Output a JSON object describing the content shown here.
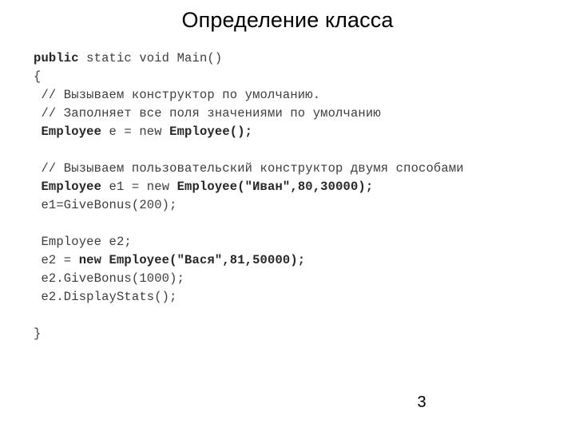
{
  "slide": {
    "title": "Определение класса",
    "page_number": "3",
    "background_color": "#ffffff",
    "text_color": "#3a3a3a",
    "title_color": "#000000"
  },
  "code": {
    "language": "csharp",
    "lines": [
      {
        "id": "line-1",
        "indent": 0,
        "tokens": [
          {
            "text": "public",
            "bold": true
          },
          {
            "text": " static void Main()",
            "bold": false
          }
        ]
      },
      {
        "id": "line-2",
        "indent": 0,
        "tokens": [
          {
            "text": "{",
            "bold": false
          }
        ]
      },
      {
        "id": "line-3",
        "indent": 1,
        "tokens": [
          {
            "text": "// Вызываем конструктор по умолчанию.",
            "bold": false
          }
        ]
      },
      {
        "id": "line-4",
        "indent": 1,
        "tokens": [
          {
            "text": "// Заполняет все поля значениями по умолчанию",
            "bold": false
          }
        ]
      },
      {
        "id": "line-5",
        "indent": 1,
        "tokens": [
          {
            "text": "Employee",
            "bold": true
          },
          {
            "text": " e = new ",
            "bold": false
          },
          {
            "text": "Employee();",
            "bold": true
          }
        ]
      },
      {
        "id": "line-6",
        "indent": 0,
        "tokens": [
          {
            "text": "",
            "bold": false
          }
        ]
      },
      {
        "id": "line-7",
        "indent": 1,
        "tokens": [
          {
            "text": "// Вызываем пользовательский конструктор двумя способами",
            "bold": false
          }
        ]
      },
      {
        "id": "line-8",
        "indent": 1,
        "tokens": [
          {
            "text": "Employee",
            "bold": true
          },
          {
            "text": " e1 = new ",
            "bold": false
          },
          {
            "text": "Employee(\"Иван\",80,30000);",
            "bold": true
          }
        ]
      },
      {
        "id": "line-9",
        "indent": 1,
        "tokens": [
          {
            "text": "e1=GiveBonus(200);",
            "bold": false
          }
        ]
      },
      {
        "id": "line-10",
        "indent": 0,
        "tokens": [
          {
            "text": "",
            "bold": false
          }
        ]
      },
      {
        "id": "line-11",
        "indent": 1,
        "tokens": [
          {
            "text": "Employee e2;",
            "bold": false
          }
        ]
      },
      {
        "id": "line-12",
        "indent": 1,
        "tokens": [
          {
            "text": "e2 = ",
            "bold": false
          },
          {
            "text": "new Employee(\"Вася\",81,50000);",
            "bold": true
          }
        ]
      },
      {
        "id": "line-13",
        "indent": 1,
        "tokens": [
          {
            "text": "e2.GiveBonus(1000);",
            "bold": false
          }
        ]
      },
      {
        "id": "line-14",
        "indent": 1,
        "tokens": [
          {
            "text": "e2.DisplayStats();",
            "bold": false
          }
        ]
      },
      {
        "id": "line-15",
        "indent": 0,
        "tokens": [
          {
            "text": "",
            "bold": false
          }
        ]
      },
      {
        "id": "line-16",
        "indent": 0,
        "tokens": [
          {
            "text": "}",
            "bold": false
          }
        ]
      }
    ]
  }
}
